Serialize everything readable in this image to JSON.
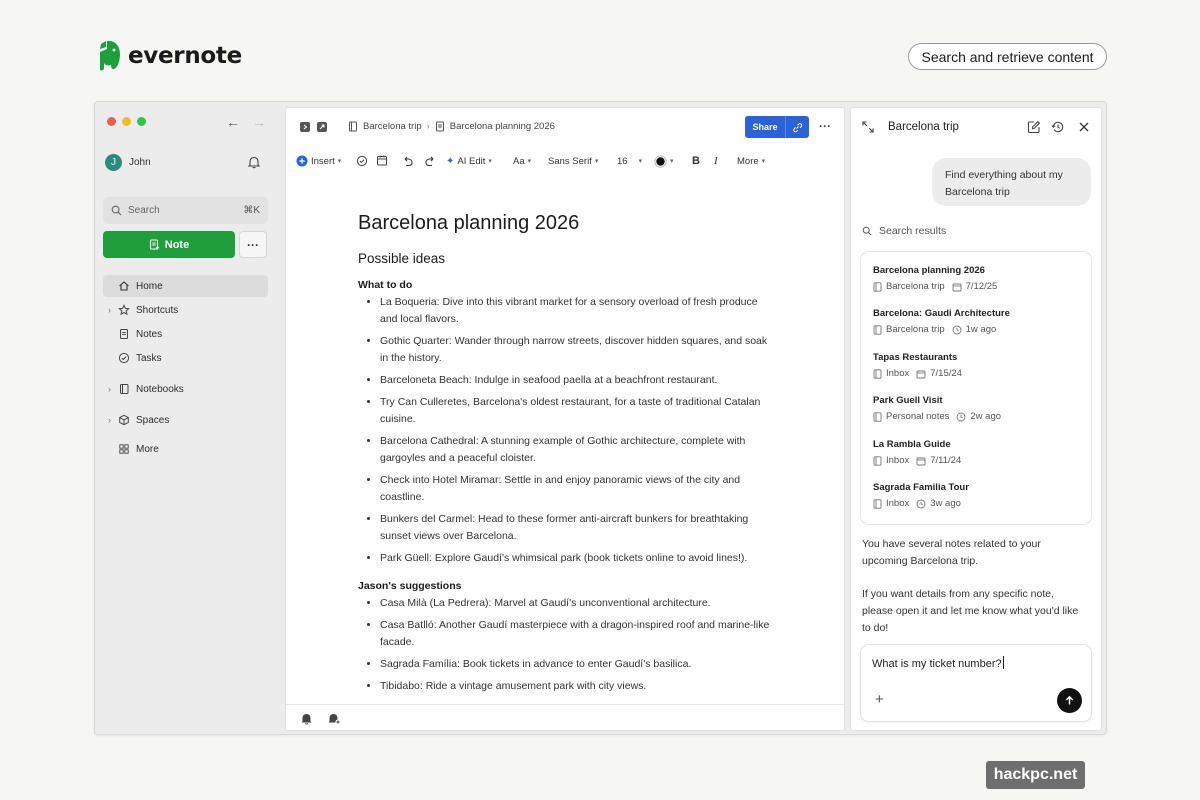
{
  "brand": {
    "name": "evernote",
    "tagline": "Search and retrieve content"
  },
  "sidebar": {
    "user": {
      "initial": "J",
      "name": "John"
    },
    "search": {
      "placeholder": "Search",
      "shortcut": "⌘K"
    },
    "new_note_label": "Note",
    "more_label": "···",
    "items": [
      {
        "label": "Home",
        "icon": "home-icon",
        "active": true
      },
      {
        "label": "Shortcuts",
        "icon": "star-icon"
      },
      {
        "label": "Notes",
        "icon": "note-icon"
      },
      {
        "label": "Tasks",
        "icon": "task-check-icon"
      },
      {
        "label": "Notebooks",
        "icon": "notebook-icon"
      },
      {
        "label": "Spaces",
        "icon": "spaces-cube-icon"
      },
      {
        "label": "More",
        "icon": "grid-icon"
      }
    ]
  },
  "editor": {
    "breadcrumb": {
      "notebook": "Barcelona trip",
      "note": "Barcelona planning 2026"
    },
    "share_label": "Share",
    "toolbar": {
      "insert": "Insert",
      "ai_edit": "AI Edit",
      "text_style": "Aa",
      "font": "Sans Serif",
      "size": "16",
      "more": "More"
    },
    "title": "Barcelona planning 2026",
    "subtitle": "Possible ideas",
    "sections": [
      {
        "heading": "What to do",
        "items": [
          "La Boqueria: Dive into this vibrant market for a sensory overload of fresh produce and local flavors.",
          "Gothic Quarter: Wander through narrow streets, discover hidden squares, and soak in the history.",
          " Barceloneta Beach: Indulge in seafood paella at a beachfront restaurant.",
          "Try Can Culleretes, Barcelona's oldest restaurant, for a taste of traditional Catalan cuisine.",
          "Barcelona Cathedral: A stunning example of Gothic architecture, complete with gargoyles and a peaceful cloister.",
          "Check into Hotel Miramar: Settle in and enjoy panoramic views of the city and coastline.",
          "Bunkers del Carmel: Head to these former anti-aircraft bunkers for breathtaking sunset views over Barcelona.",
          "Park Güell: Explore Gaudí's whimsical park (book tickets online to avoid lines!)."
        ]
      },
      {
        "heading": "Jason's suggestions",
        "items": [
          "Casa Milà (La Pedrera): Marvel at Gaudí's unconventional architecture.",
          "Casa Batlló: Another Gaudí masterpiece with a dragon-inspired roof and marine-like facade.",
          "Sagrada Família: Book tickets in advance to enter Gaudí's basilica.",
          "Tibidabo: Ride a vintage amusement park with city views."
        ]
      }
    ]
  },
  "assistant": {
    "title": "Barcelona trip",
    "user_message": "Find everything about my Barcelona trip",
    "results_label": "Search results",
    "results": [
      {
        "title": "Barcelona planning 2026",
        "notebook": "Barcelona trip",
        "time": "7/12/25",
        "time_icon": "calendar-icon"
      },
      {
        "title": "Barcelona: Gaudi Architecture",
        "notebook": "Barcelona trip",
        "time": "1w ago",
        "time_icon": "clock-icon"
      },
      {
        "title": "Tapas Restaurants",
        "notebook": "Inbox",
        "time": "7/15/24",
        "time_icon": "calendar-icon"
      },
      {
        "title": "Park Guell Visit",
        "notebook": "Personal notes",
        "time": "2w ago",
        "time_icon": "clock-icon"
      },
      {
        "title": "La Rambla Guide",
        "notebook": "Inbox",
        "time": "7/11/24",
        "time_icon": "calendar-icon"
      },
      {
        "title": "Sagrada Familia Tour",
        "notebook": "Inbox",
        "time": "3w ago",
        "time_icon": "clock-icon"
      }
    ],
    "reply_1": "You have several notes related to your upcoming Barcelona trip.",
    "reply_2": "If you want details from any specific note, please open it and let me know what you'd like to do!",
    "input_value": "What is my ticket number?"
  },
  "watermark": "hackpc.net",
  "colors": {
    "brand_green": "#1f9e3c",
    "share_blue": "#2c62d7",
    "avatar_teal": "#2a8d78"
  }
}
